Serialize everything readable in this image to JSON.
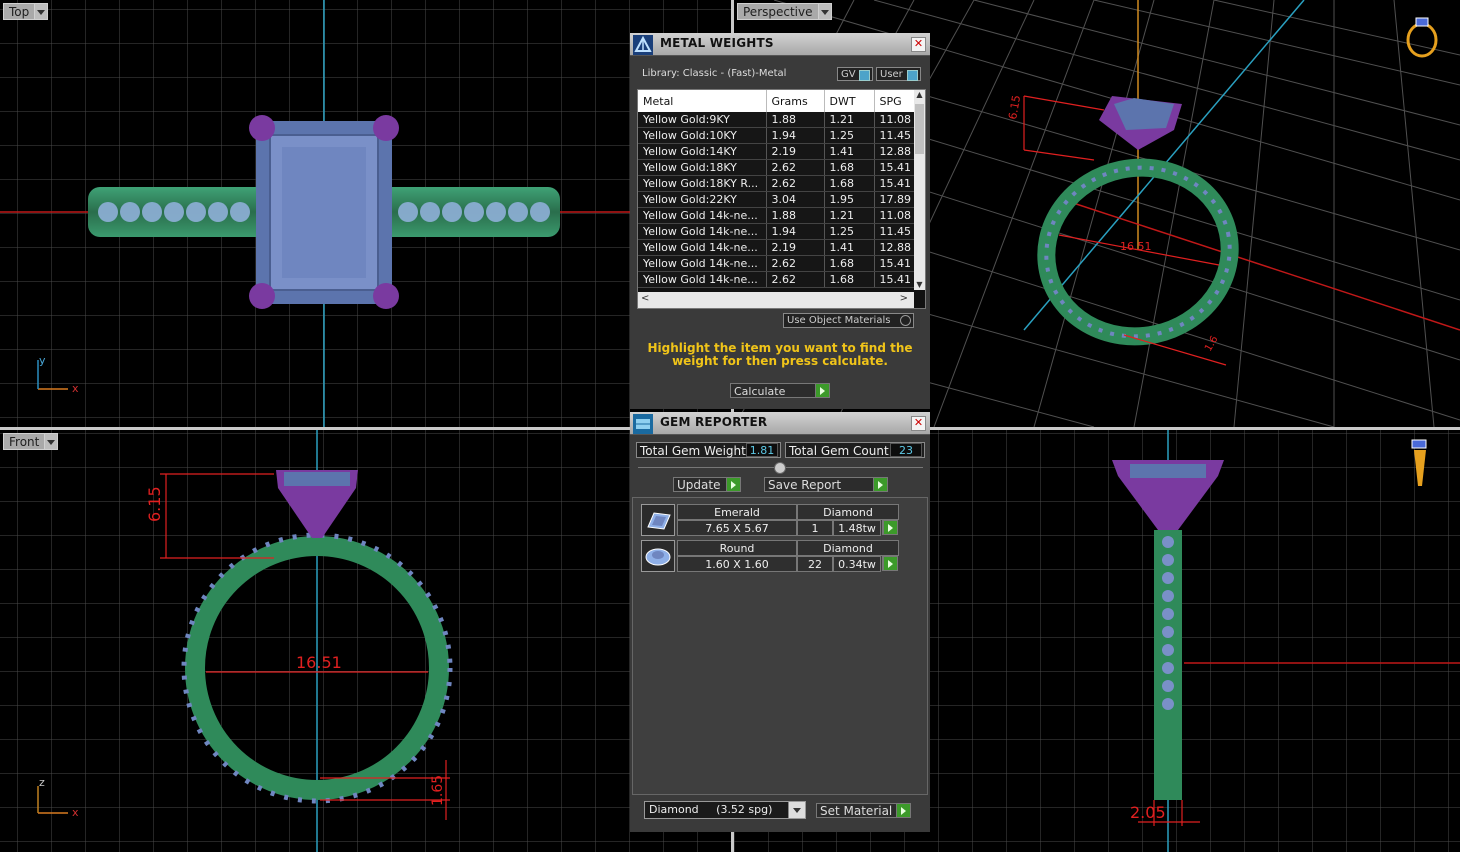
{
  "viewports": {
    "top": {
      "label": "Top",
      "axis_x": "x",
      "axis_y": "y"
    },
    "perspective": {
      "label": "Perspective",
      "dim_height": "6.15",
      "dim_diameter": "16.51",
      "dim_thickness": "1.6"
    },
    "front": {
      "label": "Front",
      "axis_x": "x",
      "axis_z": "z",
      "dim_height": "6.15",
      "dim_diameter": "16.51",
      "dim_thickness": "1.65"
    },
    "right": {
      "dim_width": "2.05"
    }
  },
  "metal_weights": {
    "title": "METAL WEIGHTS",
    "library": "Library: Classic - (Fast)-Metal",
    "toggle_gv": "GV",
    "toggle_user": "User",
    "columns": [
      "Metal",
      "Grams",
      "DWT",
      "SPG"
    ],
    "rows": [
      [
        "Yellow Gold:9KY",
        "1.88",
        "1.21",
        "11.08"
      ],
      [
        "Yellow Gold:10KY",
        "1.94",
        "1.25",
        "11.45"
      ],
      [
        "Yellow Gold:14KY",
        "2.19",
        "1.41",
        "12.88"
      ],
      [
        "Yellow Gold:18KY",
        "2.62",
        "1.68",
        "15.41"
      ],
      [
        "Yellow Gold:18KY R...",
        "2.62",
        "1.68",
        "15.41"
      ],
      [
        "Yellow Gold:22KY",
        "3.04",
        "1.95",
        "17.89"
      ],
      [
        "Yellow Gold 14k-ne...",
        "1.88",
        "1.21",
        "11.08"
      ],
      [
        "Yellow Gold 14k-ne...",
        "1.94",
        "1.25",
        "11.45"
      ],
      [
        "Yellow Gold 14k-ne...",
        "2.19",
        "1.41",
        "12.88"
      ],
      [
        "Yellow Gold 14k-ne...",
        "2.62",
        "1.68",
        "15.41"
      ],
      [
        "Yellow Gold 14k-ne...",
        "2.62",
        "1.68",
        "15.41"
      ]
    ],
    "use_object_materials": "Use Object Materials",
    "hint": "Highlight the item you want to find the weight for then press calculate.",
    "calculate": "Calculate"
  },
  "gem_reporter": {
    "title": "GEM REPORTER",
    "total_weight_label": "Total Gem Weight",
    "total_weight": "1.81",
    "total_count_label": "Total Gem Count",
    "total_count": "23",
    "update": "Update",
    "save_report": "Save Report",
    "gems": [
      {
        "cut": "Emerald",
        "material": "Diamond",
        "size": "7.65 X 5.67",
        "count": "1",
        "weight": "1.48tw"
      },
      {
        "cut": "Round",
        "material": "Diamond",
        "size": "1.60 X 1.60",
        "count": "22",
        "weight": "0.34tw"
      }
    ],
    "material_select": "Diamond     (3.52 spg)",
    "set_material": "Set Material"
  },
  "colors": {
    "grid": "#5a5a5a",
    "band": "#2f8a5a",
    "gem": "#6f86c0",
    "prong": "#7a3aa0",
    "dim": "#e02020",
    "axis_blue": "#2aa0c0"
  }
}
